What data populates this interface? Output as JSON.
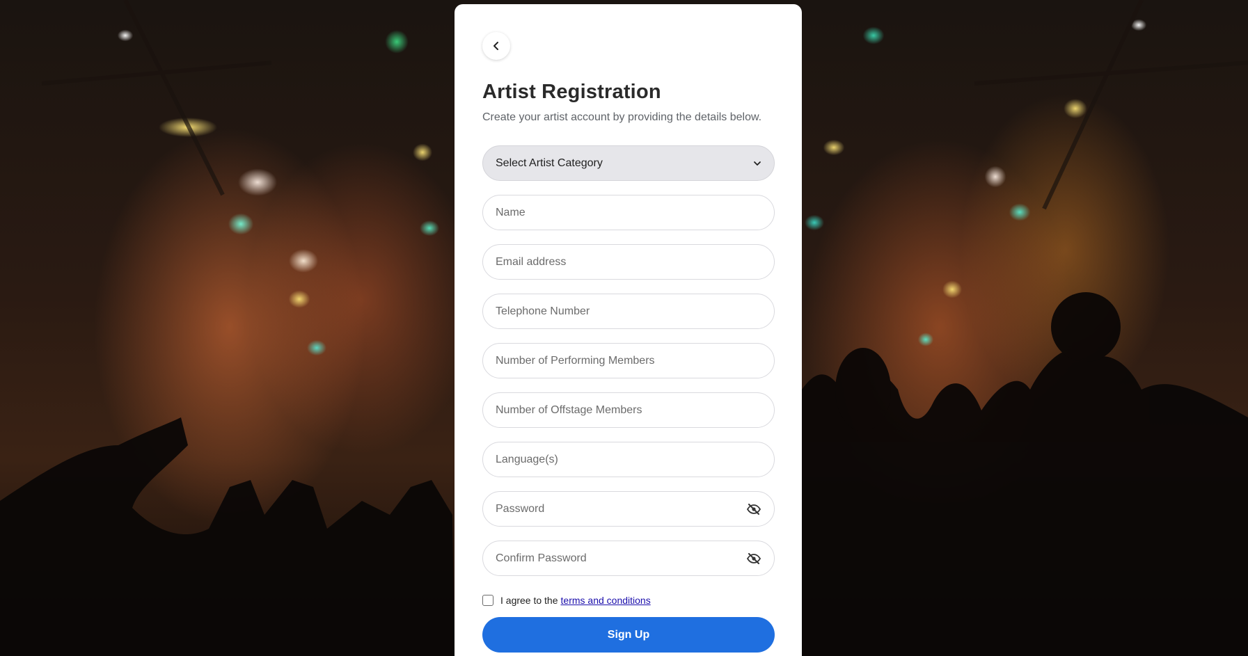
{
  "form": {
    "title": "Artist Registration",
    "subtitle": "Create your artist account by providing the details below.",
    "category_select": {
      "label": "Select Artist Category"
    },
    "fields": {
      "name": "Name",
      "email": "Email address",
      "telephone": "Telephone Number",
      "performing_members": "Number of Performing Members",
      "offstage_members": "Number of Offstage Members",
      "languages": "Language(s)",
      "password": "Password",
      "confirm_password": "Confirm Password"
    },
    "agree": {
      "prefix": "I agree to the",
      "link": "terms and conditions",
      "checked": false
    },
    "submit_label": "Sign Up"
  },
  "colors": {
    "accent": "#1f6fe0",
    "link": "#1a0dab",
    "select_bg": "#e6e6ea"
  },
  "icons": {
    "back": "chevron-left-icon",
    "select": "chevron-down-icon",
    "password_toggle": "eye-off-icon"
  }
}
